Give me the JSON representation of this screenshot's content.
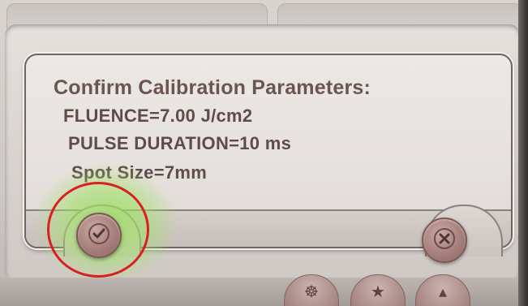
{
  "dialog": {
    "title": "Confirm Calibration Parameters:",
    "parameters": [
      "FLUENCE=7.00  J/cm2",
      "PULSE DURATION=10 ms",
      "Spot Size=7mm"
    ]
  },
  "buttons": {
    "confirm": {
      "icon": "check-icon"
    },
    "cancel": {
      "icon": "close-icon"
    }
  },
  "highlight": {
    "color": "#d9211f",
    "glow_color": "#a0e164"
  },
  "colors": {
    "text": "#6a5550",
    "button": "#a77f7a",
    "panel": "#e6e1de",
    "border": "#6e6560"
  },
  "bottom_nav": {
    "icons": [
      "wheel-icon",
      "star-icon",
      "chevron-icon"
    ]
  }
}
